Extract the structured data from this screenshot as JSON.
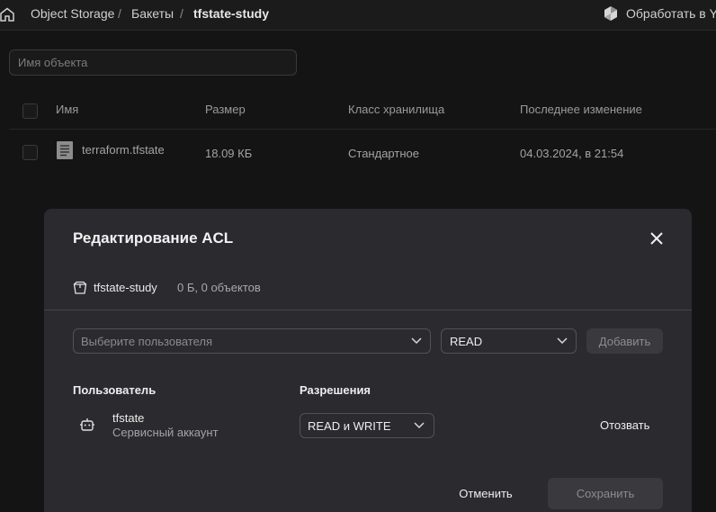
{
  "breadcrumb": {
    "items": [
      "Object Storage",
      "Бакеты",
      "tfstate-study"
    ],
    "separator": "/"
  },
  "header": {
    "yq_label": "Обработать в YQ"
  },
  "search": {
    "placeholder": "Имя объекта"
  },
  "table": {
    "columns": [
      "Имя",
      "Размер",
      "Класс хранилища",
      "Последнее изменение"
    ],
    "rows": [
      {
        "name": "terraform.tfstate",
        "size": "18.09 КБ",
        "storage_class": "Стандартное",
        "modified": "04.03.2024, в 21:54",
        "icon": "file-text-icon"
      }
    ]
  },
  "modal": {
    "title": "Редактирование ACL",
    "bucket_name": "tfstate-study",
    "bucket_meta": "0 Б, 0 объектов",
    "user_select_placeholder": "Выберите пользователя",
    "permission_select": "READ",
    "add_label": "Добавить",
    "col_user": "Пользователь",
    "col_permissions": "Разрешения",
    "entries": [
      {
        "name": "tfstate",
        "type": "Сервисный аккаунт",
        "permission": "READ и WRITE",
        "revoke_label": "Отозвать",
        "icon": "robot-icon"
      }
    ],
    "cancel_label": "Отменить",
    "save_label": "Сохранить"
  },
  "colors": {
    "background": "#141414",
    "modal_bg": "#2b2a2f",
    "disabled_button": "#3a393e"
  }
}
